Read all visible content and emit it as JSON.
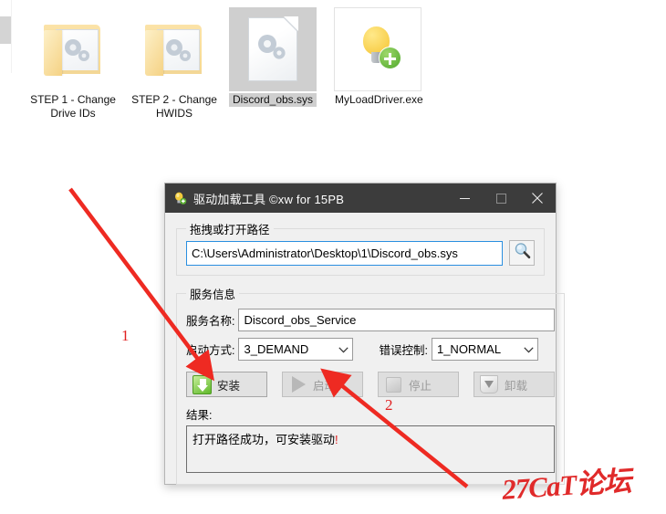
{
  "desktop": {
    "icons": [
      {
        "name": "STEP 1 - Change Drive IDs",
        "type": "folder",
        "selected": false
      },
      {
        "name": "STEP 2 - Change HWIDS",
        "type": "folder",
        "selected": false
      },
      {
        "name": "Discord_obs.sys",
        "type": "sys-file",
        "selected": true
      },
      {
        "name": "MyLoadDriver.exe",
        "type": "executable",
        "selected": false
      }
    ]
  },
  "window": {
    "title": "驱动加载工具 ©xw for 15PB",
    "icon": "lightbulb-icon",
    "controls": {
      "minimize": "minimize-icon",
      "maximize": "maximize-icon",
      "close": "close-icon"
    },
    "path_group": {
      "legend": "拖拽或打开路径",
      "path_value": "C:\\Users\\Administrator\\Desktop\\1\\Discord_obs.sys",
      "path_placeholder": "",
      "browse_icon": "magnifier-icon"
    },
    "service_group": {
      "legend": "服务信息",
      "service_name_label": "服务名称:",
      "service_name_value": "Discord_obs_Service",
      "start_type_label": "启动方式:",
      "start_type_value": "3_DEMAND",
      "error_control_label": "错误控制:",
      "error_control_value": "1_NORMAL",
      "buttons": [
        {
          "label": "安装",
          "icon": "download-icon",
          "enabled": true
        },
        {
          "label": "启动",
          "icon": "play-icon",
          "enabled": false
        },
        {
          "label": "停止",
          "icon": "stop-icon",
          "enabled": false
        },
        {
          "label": "卸载",
          "icon": "trash-icon",
          "enabled": false
        }
      ],
      "result_label": "结果:",
      "result_text": "打开路径成功，可安装驱动",
      "result_exclaim": "!"
    }
  },
  "annotations": {
    "marker_one": "1",
    "marker_two": "2",
    "arrow_color": "#ee2a22"
  },
  "watermark": {
    "text": "27CaT论坛",
    "color": "#e02a2a"
  }
}
